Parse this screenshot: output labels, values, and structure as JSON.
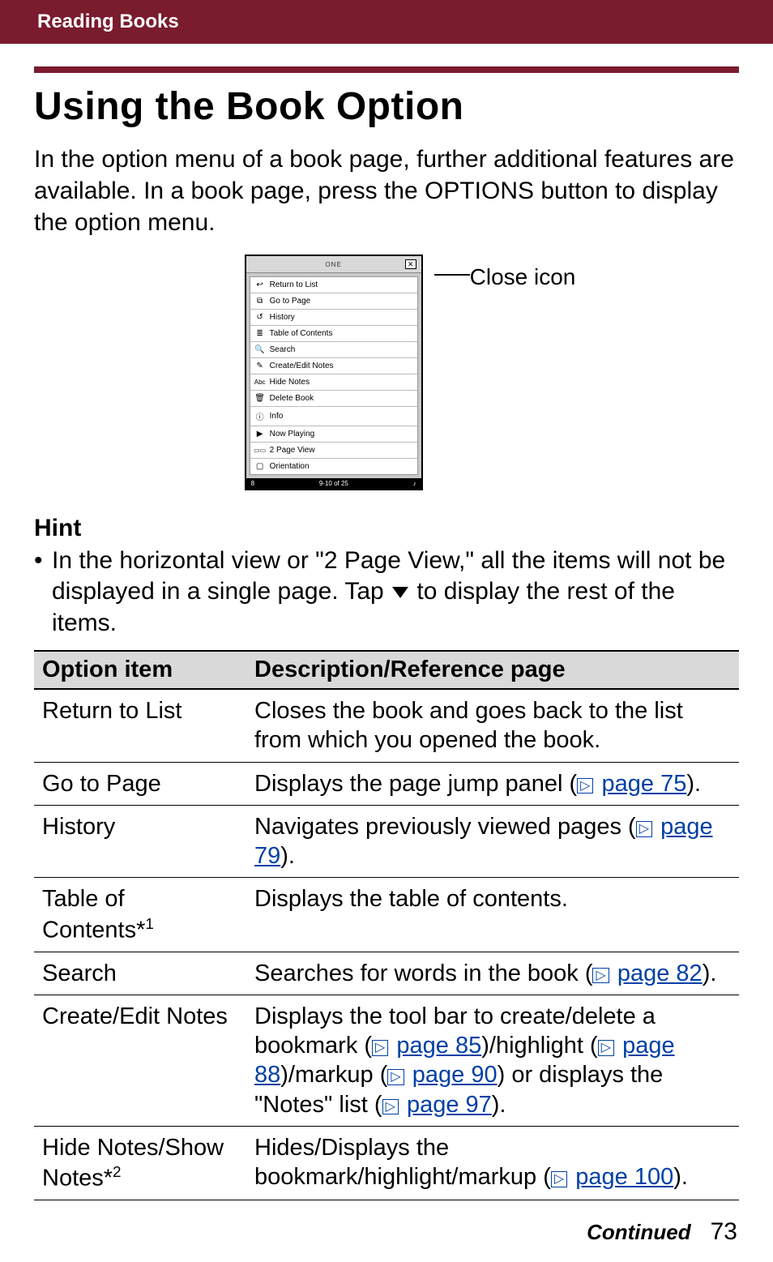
{
  "header": {
    "breadcrumb": "Reading Books"
  },
  "title": "Using the Book Option",
  "intro": "In the option menu of a book page, further additional features are available. In a book page, press the OPTIONS button to display the option menu.",
  "figure": {
    "callout": "Close icon",
    "device_brand": "ONE",
    "close_glyph": "✕",
    "menu": [
      {
        "icon": "↩",
        "label": "Return to List"
      },
      {
        "icon": "⧉",
        "label": "Go to Page"
      },
      {
        "icon": "↺",
        "label": "History"
      },
      {
        "icon": "≣",
        "label": "Table of Contents"
      },
      {
        "icon": "🔍",
        "label": "Search"
      },
      {
        "icon": "✎",
        "label": "Create/Edit Notes"
      },
      {
        "icon": "Abc",
        "label": "Hide Notes"
      },
      {
        "icon": "🗑",
        "label": "Delete Book"
      },
      {
        "icon": "ⓘ",
        "label": "Info"
      },
      {
        "icon": "▶",
        "label": "Now Playing"
      },
      {
        "icon": "▭▭",
        "label": "2 Page View"
      },
      {
        "icon": "▢",
        "label": "Orientation"
      }
    ],
    "footer_left": "8",
    "footer_center": "9-10 of 25"
  },
  "hint": {
    "heading": "Hint",
    "bullet_prefix": "•",
    "text_a": "In the horizontal view or \"2 Page View,\" all the items will not be displayed in a single page. Tap ",
    "text_b": " to display the rest of the items."
  },
  "table": {
    "head_item": "Option item",
    "head_desc": "Description/Reference page",
    "rows": {
      "return_to_list": {
        "item": "Return to List",
        "desc": "Closes the book and goes back to the list from which you opened the book."
      },
      "go_to_page": {
        "item": "Go to Page",
        "desc_a": "Displays the page jump panel (",
        "ref": "page 75",
        "desc_b": ")."
      },
      "history": {
        "item": "History",
        "desc_a": "Navigates previously viewed pages (",
        "ref": "page 79",
        "desc_b": ")."
      },
      "toc": {
        "item_a": "Table of Contents*",
        "item_sup": "1",
        "desc": "Displays the table of contents."
      },
      "search": {
        "item": "Search",
        "desc_a": "Searches for words in the book (",
        "ref": "page 82",
        "desc_b": ")."
      },
      "notes": {
        "item": "Create/Edit Notes",
        "d1": "Displays the tool bar to create/delete a bookmark (",
        "r1": "page 85",
        "d2": ")/highlight (",
        "r2": "page 88",
        "d3": ")/markup (",
        "r3": "page 90",
        "d4": ") or displays the \"Notes\" list (",
        "r4": "page 97",
        "d5": ")."
      },
      "hide_notes": {
        "item_a": "Hide Notes/Show Notes*",
        "item_sup": "2",
        "desc_a": "Hides/Displays the bookmark/highlight/markup (",
        "ref": "page 100",
        "desc_b": ")."
      }
    }
  },
  "ref_icon_glyph": "▷",
  "footer": {
    "continued": "Continued",
    "page_number": "73"
  }
}
